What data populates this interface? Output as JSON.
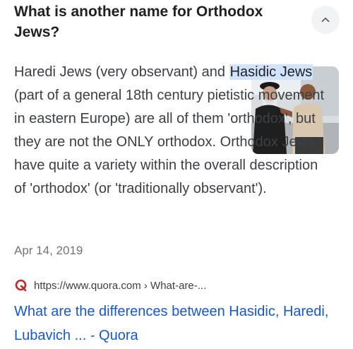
{
  "question": "What is another name for Orthodox Jews?",
  "snippet": {
    "part1": "Haredi Jews (very observant) and ",
    "highlight": "Hasidic Jews",
    "part2": " (part of a general 18th century pietistic movement in eastern Europe) are all of them 'orthodox', but they are not the ONLY orthodox. Orthodox Jews have quite a variety within the overall description of 'orthodox' (or 'traditionally observant')."
  },
  "date": "Apr 14, 2019",
  "source": {
    "url": "https://www.quora.com › What-are-...",
    "icon": "quora-icon"
  },
  "result_title": "What are the differences between Hasidic, Haredi, Lubavich ... - Quora",
  "icons": {
    "collapse": "chevron-up-icon"
  },
  "colors": {
    "link": "#1558d6",
    "highlight": "#d2e3fc",
    "quora": "#b92b27"
  }
}
